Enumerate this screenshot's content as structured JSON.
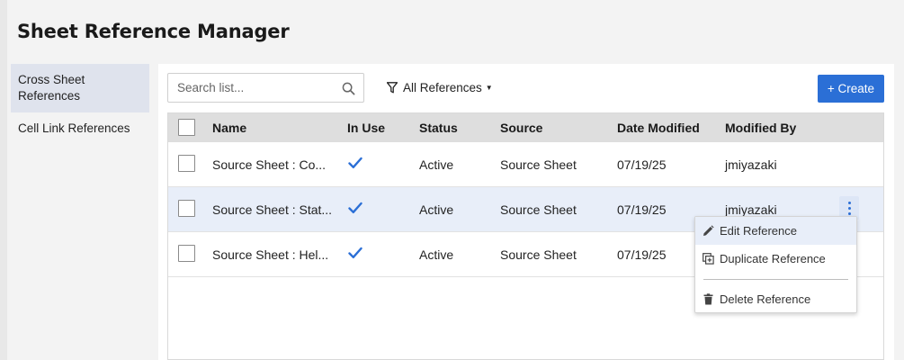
{
  "page": {
    "title": "Sheet Reference Manager"
  },
  "sidebar": {
    "items": [
      {
        "label": "Cross Sheet References",
        "active": true
      },
      {
        "label": "Cell Link References",
        "active": false
      }
    ]
  },
  "toolbar": {
    "search_placeholder": "Search list...",
    "search_value": "",
    "filter_label": "All References",
    "create_label": "+ Create",
    "create_color": "#2b6fd6"
  },
  "table": {
    "headers": {
      "name": "Name",
      "in_use": "In Use",
      "status": "Status",
      "source": "Source",
      "date_modified": "Date Modified",
      "modified_by": "Modified By"
    },
    "rows": [
      {
        "name": "Source Sheet : Co...",
        "in_use": true,
        "status": "Active",
        "source": "Source Sheet",
        "date_modified": "07/19/25",
        "modified_by": "jmiyazaki"
      },
      {
        "name": "Source Sheet : Stat...",
        "in_use": true,
        "status": "Active",
        "source": "Source Sheet",
        "date_modified": "07/19/25",
        "modified_by": "jmiyazaki",
        "selected": true
      },
      {
        "name": "Source Sheet : Hel...",
        "in_use": true,
        "status": "Active",
        "source": "Source Sheet",
        "date_modified": "07/19/25",
        "modified_by": ""
      }
    ]
  },
  "context_menu": {
    "items": [
      {
        "label": "Edit Reference",
        "icon": "pencil-icon"
      },
      {
        "label": "Duplicate Reference",
        "icon": "duplicate-icon"
      },
      {
        "label": "Delete Reference",
        "icon": "trash-icon"
      }
    ]
  },
  "colors": {
    "accent": "#2b6fd6",
    "check": "#2b6fd6",
    "selected_row": "#e8eef9"
  }
}
